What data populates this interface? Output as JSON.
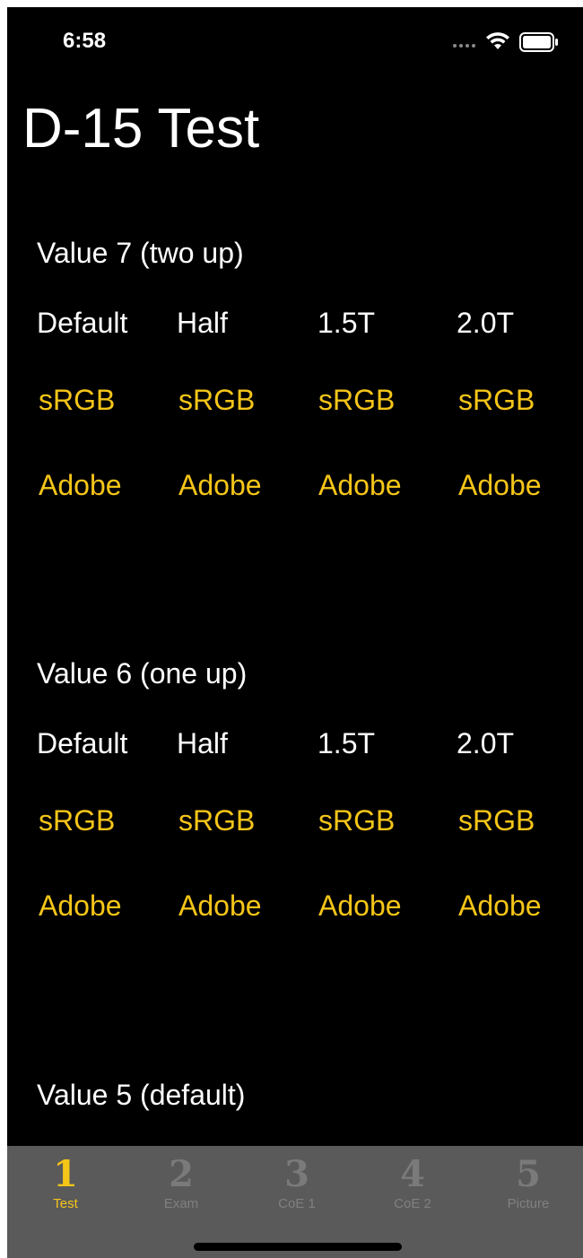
{
  "status": {
    "time": "6:58"
  },
  "title": "D-15 Test",
  "sections": [
    {
      "heading": "Value 7 (two up)",
      "columns": [
        "Default",
        "Half",
        "1.5T",
        "2.0T"
      ],
      "srgb": [
        "sRGB",
        "sRGB",
        "sRGB",
        "sRGB"
      ],
      "adobe": [
        "Adobe",
        "Adobe",
        "Adobe",
        "Adobe"
      ]
    },
    {
      "heading": "Value 6 (one up)",
      "columns": [
        "Default",
        "Half",
        "1.5T",
        "2.0T"
      ],
      "srgb": [
        "sRGB",
        "sRGB",
        "sRGB",
        "sRGB"
      ],
      "adobe": [
        "Adobe",
        "Adobe",
        "Adobe",
        "Adobe"
      ]
    },
    {
      "heading": "Value 5 (default)"
    }
  ],
  "tabs": [
    {
      "number": "1",
      "label": "Test",
      "active": true
    },
    {
      "number": "2",
      "label": "Exam",
      "active": false
    },
    {
      "number": "3",
      "label": "CoE 1",
      "active": false
    },
    {
      "number": "4",
      "label": "CoE 2",
      "active": false
    },
    {
      "number": "5",
      "label": "Picture",
      "active": false
    }
  ],
  "colors": {
    "accent": "#f5c518",
    "background": "#000000",
    "tab_bar": "#5a5a5a",
    "inactive_tab": "#808080"
  }
}
